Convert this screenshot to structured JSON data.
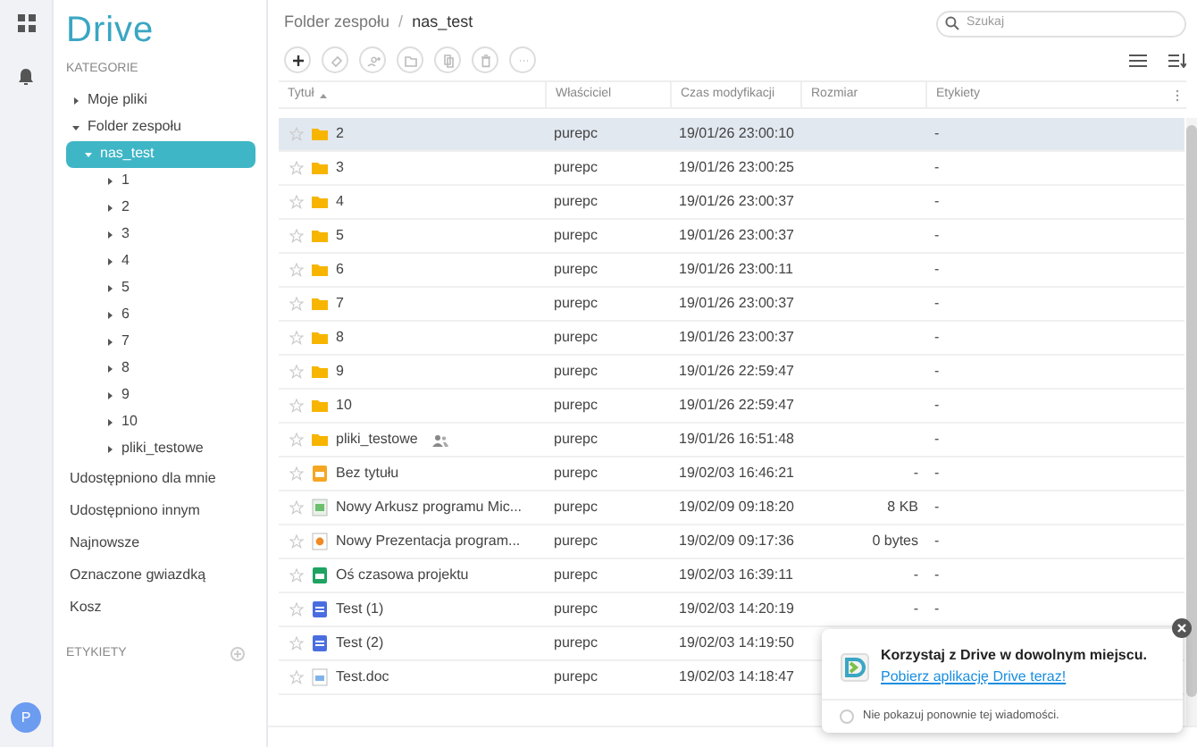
{
  "app": {
    "logo": "Drive",
    "avatar": "P"
  },
  "sidebar": {
    "categories_heading": "KATEGORIE",
    "tree": [
      {
        "label": "Moje pliki",
        "expanded": false,
        "selected": false
      },
      {
        "label": "Folder zespołu",
        "expanded": true,
        "selected": false,
        "children": [
          {
            "label": "nas_test",
            "expanded": true,
            "selected": true,
            "children": [
              {
                "label": "1",
                "expanded": false,
                "selected": false
              },
              {
                "label": "2",
                "expanded": false,
                "selected": false
              },
              {
                "label": "3",
                "expanded": false,
                "selected": false
              },
              {
                "label": "4",
                "expanded": false,
                "selected": false
              },
              {
                "label": "5",
                "expanded": false,
                "selected": false
              },
              {
                "label": "6",
                "expanded": false,
                "selected": false
              },
              {
                "label": "7",
                "expanded": false,
                "selected": false
              },
              {
                "label": "8",
                "expanded": false,
                "selected": false
              },
              {
                "label": "9",
                "expanded": false,
                "selected": false
              },
              {
                "label": "10",
                "expanded": false,
                "selected": false
              },
              {
                "label": "pliki_testowe",
                "expanded": false,
                "selected": false
              }
            ]
          }
        ]
      }
    ],
    "items": [
      "Udostępniono dla mnie",
      "Udostępniono innym",
      "Najnowsze",
      "Oznaczone gwiazdką",
      "Kosz"
    ],
    "labels_heading": "ETYKIETY"
  },
  "breadcrumb": [
    "Folder zespołu",
    "nas_test"
  ],
  "breadcrumb_separator": "/",
  "search": {
    "placeholder": "Szukaj"
  },
  "table": {
    "columns": [
      "Tytuł",
      "Właściciel",
      "Czas modyfikacji",
      "Rozmiar",
      "Etykiety"
    ],
    "rows": [
      {
        "kind": "folder",
        "title": "2",
        "owner": "purepc",
        "modified": "19/01/26 23:00:10",
        "labels": "-",
        "selected": true,
        "shared": false
      },
      {
        "kind": "folder",
        "title": "3",
        "owner": "purepc",
        "modified": "19/01/26 23:00:25",
        "labels": "-",
        "selected": false,
        "shared": false
      },
      {
        "kind": "folder",
        "title": "4",
        "owner": "purepc",
        "modified": "19/01/26 23:00:37",
        "labels": "-",
        "selected": false,
        "shared": false
      },
      {
        "kind": "folder",
        "title": "5",
        "owner": "purepc",
        "modified": "19/01/26 23:00:37",
        "labels": "-",
        "selected": false,
        "shared": false
      },
      {
        "kind": "folder",
        "title": "6",
        "owner": "purepc",
        "modified": "19/01/26 23:00:11",
        "labels": "-",
        "selected": false,
        "shared": false
      },
      {
        "kind": "folder",
        "title": "7",
        "owner": "purepc",
        "modified": "19/01/26 23:00:37",
        "labels": "-",
        "selected": false,
        "shared": false
      },
      {
        "kind": "folder",
        "title": "8",
        "owner": "purepc",
        "modified": "19/01/26 23:00:37",
        "labels": "-",
        "selected": false,
        "shared": false
      },
      {
        "kind": "folder",
        "title": "9",
        "owner": "purepc",
        "modified": "19/01/26 22:59:47",
        "labels": "-",
        "selected": false,
        "shared": false
      },
      {
        "kind": "folder",
        "title": "10",
        "owner": "purepc",
        "modified": "19/01/26 22:59:47",
        "labels": "-",
        "selected": false,
        "shared": false
      },
      {
        "kind": "folder",
        "title": "pliki_testowe",
        "owner": "purepc",
        "modified": "19/01/26 16:51:48",
        "labels": "-",
        "selected": false,
        "shared": true
      },
      {
        "kind": "slides",
        "title": "Bez tytułu",
        "owner": "purepc",
        "modified": "19/02/03 16:46:21",
        "size": "-",
        "labels": "-",
        "selected": false,
        "shared": false
      },
      {
        "kind": "xlsx",
        "title": "Nowy Arkusz programu Mic...",
        "owner": "purepc",
        "modified": "19/02/09 09:18:20",
        "size": "8 KB",
        "labels": "-",
        "selected": false,
        "shared": false
      },
      {
        "kind": "pptx",
        "title": "Nowy Prezentacja program...",
        "owner": "purepc",
        "modified": "19/02/09 09:17:36",
        "size": "0 bytes",
        "labels": "-",
        "selected": false,
        "shared": false
      },
      {
        "kind": "sheet",
        "title": "Oś czasowa projektu",
        "owner": "purepc",
        "modified": "19/02/03 16:39:11",
        "size": "-",
        "labels": "-",
        "selected": false,
        "shared": false
      },
      {
        "kind": "doc",
        "title": "Test (1)",
        "owner": "purepc",
        "modified": "19/02/03 14:20:19",
        "size": "-",
        "labels": "-",
        "selected": false,
        "shared": false
      },
      {
        "kind": "doc",
        "title": "Test (2)",
        "owner": "purepc",
        "modified": "19/02/03 14:19:50",
        "selected": false,
        "shared": false
      },
      {
        "kind": "docfile",
        "title": "Test.doc",
        "owner": "purepc",
        "modified": "19/02/03 14:18:47",
        "selected": false,
        "shared": false
      }
    ]
  },
  "promo": {
    "title": "Korzystaj z Drive w dowolnym miejscu.",
    "link": "Pobierz aplikację Drive teraz!",
    "dont_show": "Nie pokazuj ponownie tej wiadomości.",
    "checked": false
  }
}
